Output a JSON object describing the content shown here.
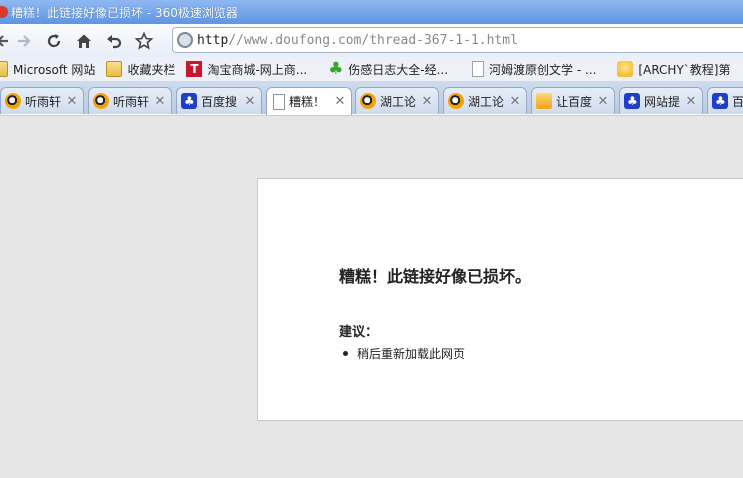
{
  "window": {
    "title": "糟糕！此链接好像已损坏 - 360极速浏览器"
  },
  "toolbar": {
    "icons": [
      "back-icon",
      "forward-icon",
      "refresh-icon",
      "home-icon",
      "undo-icon",
      "star-icon"
    ],
    "address": {
      "scheme": "http",
      "rest": "//www.doufong.com/thread-367-1-1.html"
    }
  },
  "bookmarks": [
    {
      "label": "Microsoft 网站",
      "icon": "folder-icon"
    },
    {
      "label": "收藏夹栏",
      "icon": "folder-icon"
    },
    {
      "label": "淘宝商城-网上商...",
      "icon": "taobao-icon",
      "glyph": "T"
    },
    {
      "label": "伤感日志大全-经...",
      "icon": "clover-icon"
    },
    {
      "label": "河姆渡原创文学 - ...",
      "icon": "page-icon"
    },
    {
      "label": "[ARCHY`教程]第",
      "icon": "trophy-icon"
    }
  ],
  "tabs": [
    {
      "label": "听雨轩",
      "icon": "bird-icon",
      "active": false
    },
    {
      "label": "听雨轩",
      "icon": "bird-icon",
      "active": false
    },
    {
      "label": "百度搜",
      "icon": "paw-icon",
      "active": false
    },
    {
      "label": "糟糕！",
      "icon": "document-icon",
      "active": true
    },
    {
      "label": "湖工论",
      "icon": "bird-icon",
      "active": false
    },
    {
      "label": "湖工论",
      "icon": "bird-icon",
      "active": false
    },
    {
      "label": "让百度",
      "icon": "mail-icon",
      "active": false
    },
    {
      "label": "网站提",
      "icon": "paw-icon",
      "active": false
    },
    {
      "label": "百",
      "icon": "paw-icon",
      "active": false
    }
  ],
  "error_page": {
    "title": "糟糕！此链接好像已损坏。",
    "suggestion_heading": "建议：",
    "suggestions": [
      "稍后重新加载此网页"
    ]
  }
}
